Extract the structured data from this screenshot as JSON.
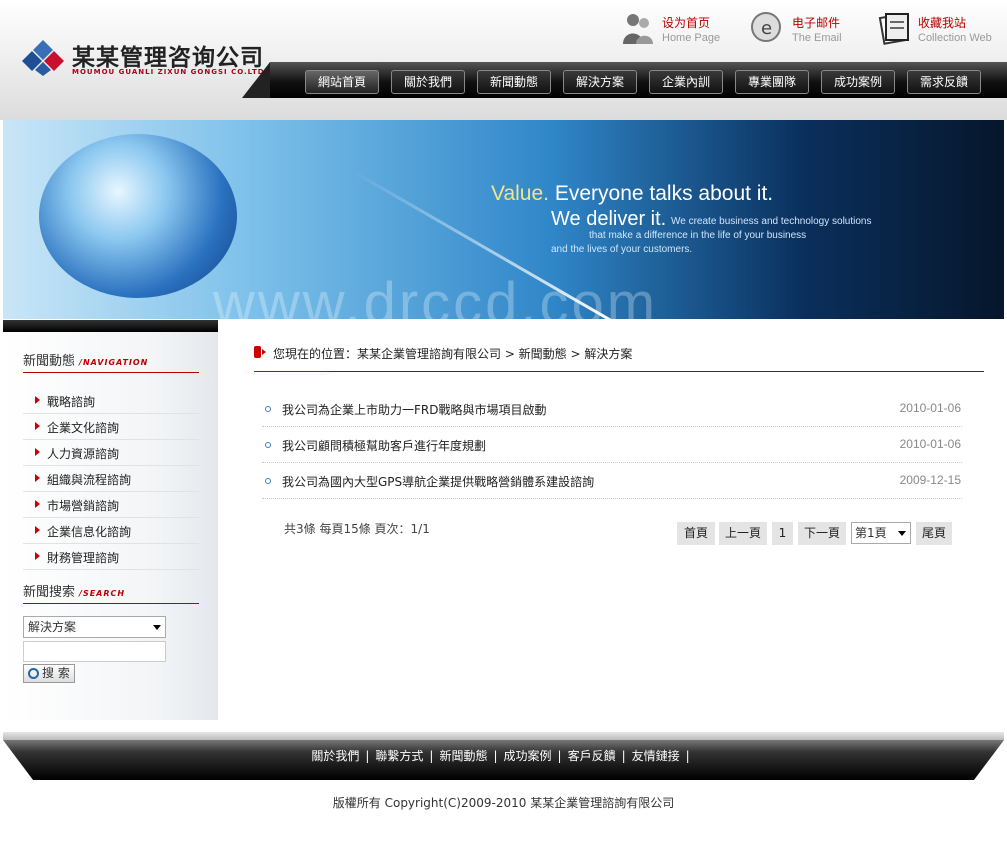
{
  "brand": {
    "name": "某某管理咨询公司",
    "subtitle": "MOUMOU GUANLI ZIXUN GONGSI CO.LTD."
  },
  "toplinks": [
    {
      "cn": "设为首页",
      "en": "Home Page"
    },
    {
      "cn": "电子邮件",
      "en": "The Email"
    },
    {
      "cn": "收藏我站",
      "en": "Collection Web"
    }
  ],
  "nav": [
    "網站首頁",
    "關於我們",
    "新聞動態",
    "解決方案",
    "企業內訓",
    "專業團隊",
    "成功案例",
    "需求反饋"
  ],
  "banner": {
    "value": "Value.",
    "line1": "Everyone talks about it.",
    "line2": "We deliver it.",
    "line3": "We create business and technology solutions",
    "line4": "that make a difference in the life of your business",
    "line5": "and the lives of your customers.",
    "watermark": "www.drccd.com"
  },
  "sidebar": {
    "nav_title": "新聞動態",
    "nav_title_en": "/NAVIGATION",
    "items": [
      "戰略諮詢",
      "企業文化諮詢",
      "人力資源諮詢",
      "組織與流程諮詢",
      "市場營銷諮詢",
      "企業信息化諮詢",
      "財務管理諮詢"
    ],
    "search_title": "新聞搜索",
    "search_title_en": "/SEARCH",
    "search_category": "解決方案",
    "search_keyword": "",
    "search_button": "搜 索"
  },
  "breadcrumb": "您現在的位置：某某企業管理諮詢有限公司 > 新聞動態 > 解決方案",
  "news": [
    {
      "title": "我公司為企業上市助力一FRD戰略與市場項目啟動",
      "date": "2010-01-06"
    },
    {
      "title": "我公司顧問積極幫助客戶進行年度規劃",
      "date": "2010-01-06"
    },
    {
      "title": "我公司為國內大型GPS導航企業提供戰略營銷體系建設諮詢",
      "date": "2009-12-15"
    }
  ],
  "pagination": {
    "info": "共3條 每頁15條 頁次：1/1",
    "first": "首頁",
    "prev": "上一頁",
    "current": "1",
    "next": "下一頁",
    "select": "第1頁",
    "last": "尾頁"
  },
  "footer": {
    "links": [
      "關於我們",
      "聯繫方式",
      "新聞動態",
      "成功案例",
      "客戶反饋",
      "友情鏈接"
    ],
    "separator": "|",
    "copyright": "版權所有 Copyright(C)2009-2010 某某企業管理諮詢有限公司"
  },
  "colors": {
    "accent": "#cc0000",
    "nav_bg": "#111111"
  },
  "icons": {
    "logo": "diamond-logo-icon",
    "home": "user-home-icon",
    "email": "email-icon",
    "bookmark": "bookmark-icon",
    "search": "magnifier-icon"
  }
}
